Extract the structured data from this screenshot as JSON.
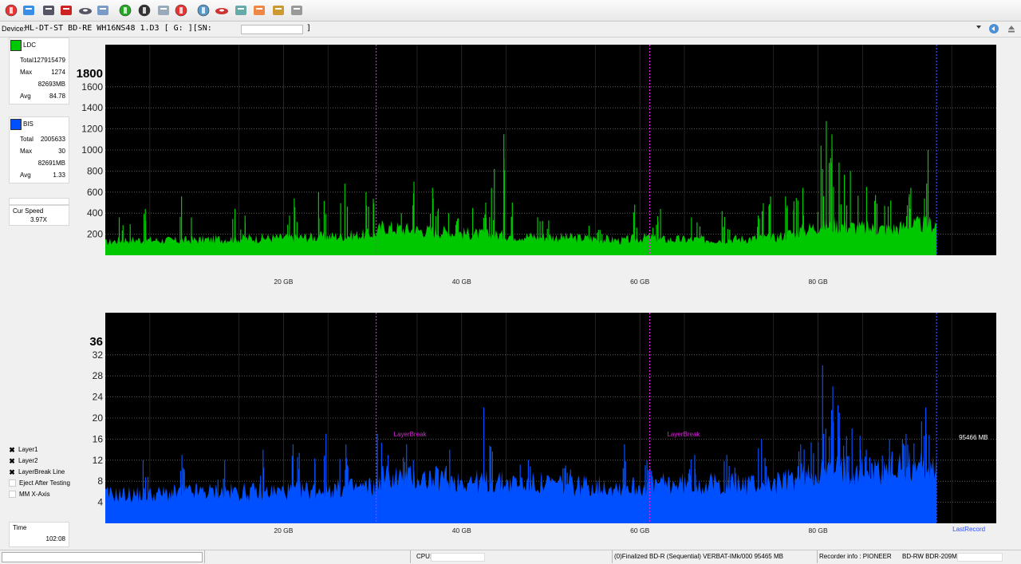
{
  "device": {
    "label": "Device:",
    "name": "HL-DT-ST BD-RE  WH16NS48  1.D3 [ G: ][SN:",
    "sn_close": "]"
  },
  "toolbar_icons": [
    "power-icon",
    "config-icon",
    "device-icon",
    "disc-erase-icon",
    "disc-icon",
    "scan-icon",
    "refresh-icon",
    "record-icon",
    "check-icon",
    "stop-icon",
    "disc-info-icon",
    "burn-icon",
    "globe-icon",
    "tools-icon",
    "chart-icon",
    "print-icon"
  ],
  "legend": {
    "ldc": {
      "name": "LDC",
      "color": "#00c800",
      "total_label": "Total",
      "total": "127915479",
      "max_label": "Max",
      "max": "1274",
      "max_pos": "82693MB",
      "avg_label": "Avg",
      "avg": "84.78"
    },
    "bis": {
      "name": "BIS",
      "color": "#0050ff",
      "total_label": "Total",
      "total": "2005633",
      "max_label": "Max",
      "max": "30",
      "max_pos": "82691MB",
      "avg_label": "Avg",
      "avg": "1.33"
    },
    "speed_label": "Cur Speed",
    "speed": "3.97X"
  },
  "options": [
    {
      "label": "Layer1",
      "checked": true
    },
    {
      "label": "Layer2",
      "checked": true
    },
    {
      "label": "LayerBreak Line",
      "checked": true
    },
    {
      "label": "Eject After Testing",
      "checked": false
    },
    {
      "label": "MM X-Axis",
      "checked": false
    }
  ],
  "time": {
    "label": "Time",
    "value": "102:08"
  },
  "chart_data": [
    {
      "type": "area",
      "series": [
        {
          "name": "LDC",
          "color": "#00c800"
        }
      ],
      "yticks": [
        200,
        400,
        600,
        800,
        1000,
        1200,
        1400,
        1600
      ],
      "ytop_label": "1800",
      "ylim": [
        0,
        2000
      ],
      "xticks": [
        20,
        40,
        60,
        80
      ],
      "xtick_labels": [
        "20 GB",
        "40 GB",
        "60 GB",
        "80 GB"
      ],
      "xlim": [
        0,
        100
      ],
      "data_end": 93.3,
      "layer_breaks": [
        30.4,
        61.1
      ],
      "profile_x": [
        0,
        2,
        8,
        15,
        22,
        28,
        30.4,
        31,
        35,
        42,
        48,
        55,
        58,
        61.1,
        62,
        68,
        75,
        80.5,
        82,
        85,
        88,
        91,
        93.3
      ],
      "profile_y": [
        120,
        150,
        140,
        160,
        170,
        190,
        210,
        270,
        240,
        200,
        180,
        160,
        140,
        175,
        150,
        150,
        165,
        290,
        290,
        260,
        250,
        290,
        300
      ],
      "peaks": [
        [
          2,
          360
        ],
        [
          5,
          440
        ],
        [
          9,
          560
        ],
        [
          15,
          440
        ],
        [
          21,
          540
        ],
        [
          24,
          600
        ],
        [
          27,
          680
        ],
        [
          30,
          600
        ],
        [
          34,
          700
        ],
        [
          37,
          640
        ],
        [
          39,
          400
        ],
        [
          42,
          500
        ],
        [
          43,
          640
        ],
        [
          44,
          1150
        ],
        [
          45,
          500
        ],
        [
          49,
          360
        ],
        [
          55,
          280
        ],
        [
          59,
          480
        ],
        [
          62,
          440
        ],
        [
          66,
          360
        ],
        [
          70,
          420
        ],
        [
          73,
          420
        ],
        [
          74,
          560
        ],
        [
          77,
          560
        ],
        [
          78,
          640
        ],
        [
          80,
          560
        ],
        [
          81,
          1274
        ],
        [
          82,
          1150
        ],
        [
          83,
          880
        ],
        [
          84,
          800
        ],
        [
          86,
          650
        ],
        [
          88,
          520
        ],
        [
          90,
          580
        ],
        [
          91,
          640
        ],
        [
          92,
          1000
        ]
      ]
    },
    {
      "type": "area",
      "series": [
        {
          "name": "BIS",
          "color": "#0050ff"
        }
      ],
      "yticks": [
        4,
        8,
        12,
        16,
        20,
        24,
        28,
        32
      ],
      "ytop_label": "36",
      "ylim": [
        0,
        40
      ],
      "xticks": [
        20,
        40,
        60,
        80
      ],
      "xtick_labels": [
        "20 GB",
        "40 GB",
        "60 GB",
        "80 GB"
      ],
      "xlim": [
        0,
        100
      ],
      "data_end": 93.3,
      "layer_breaks": [
        30.4,
        61.1
      ],
      "layer_break_label": "LayerBreak",
      "end_label": "95466 MB",
      "end_caption": "LastRecord",
      "profile_x": [
        0,
        5,
        10,
        18,
        25,
        30.4,
        31,
        36,
        42,
        50,
        58,
        61.1,
        62,
        68,
        75,
        80.5,
        82,
        86,
        90,
        93.3
      ],
      "profile_y": [
        5.5,
        5.5,
        6,
        6,
        6.5,
        7,
        9,
        8.5,
        8,
        7.5,
        7,
        7,
        7.5,
        7.5,
        7.5,
        10,
        10.5,
        10,
        11,
        11
      ],
      "peaks": [
        [
          4,
          12
        ],
        [
          9,
          13
        ],
        [
          13,
          12
        ],
        [
          18,
          14
        ],
        [
          21,
          15
        ],
        [
          24,
          17
        ],
        [
          27,
          15
        ],
        [
          31,
          17
        ],
        [
          34,
          15
        ],
        [
          38,
          14
        ],
        [
          43,
          22
        ],
        [
          47,
          12
        ],
        [
          52,
          11
        ],
        [
          58,
          15
        ],
        [
          61,
          12
        ],
        [
          66,
          13
        ],
        [
          70,
          13
        ],
        [
          74,
          16
        ],
        [
          78,
          15
        ],
        [
          80,
          17
        ],
        [
          81,
          30
        ],
        [
          82,
          26
        ],
        [
          83,
          21
        ],
        [
          84,
          18
        ],
        [
          86,
          14
        ],
        [
          88,
          16
        ],
        [
          90,
          17
        ],
        [
          92,
          22
        ]
      ]
    }
  ],
  "status": {
    "cpu_label": "CPU:",
    "disc": "(0)Finalized  BD-R (Sequential)  VERBAT-IMk/000  95465 MB",
    "recorder_label": "Recorder info : PIONEER",
    "recorder": "BD-RW   BDR-209M"
  }
}
